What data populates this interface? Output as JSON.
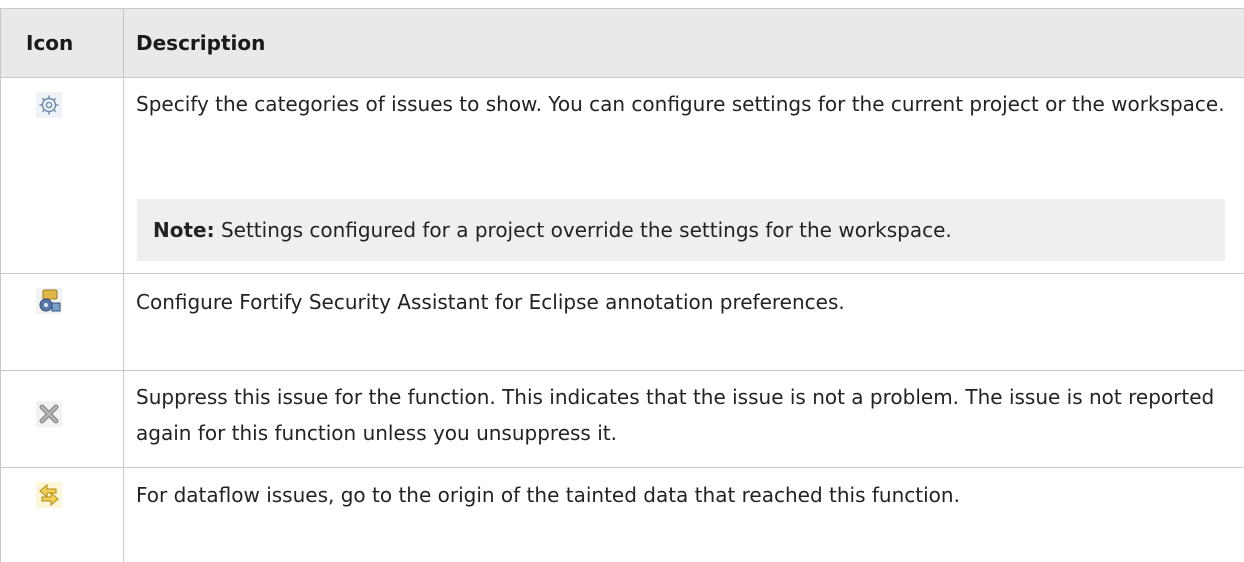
{
  "header": {
    "icon_col": "Icon",
    "description_col": "Description"
  },
  "rows": [
    {
      "icon": "gear-icon",
      "description": "Specify the categories of issues to show. You can configure settings for the current project or the workspace.",
      "note_label": "Note:",
      "note_text": " Settings configured for a project override the settings for the workspace."
    },
    {
      "icon": "annotation-preferences-icon",
      "description": "Configure Fortify Security Assistant for Eclipse annotation preferences."
    },
    {
      "icon": "suppress-icon",
      "description": "Suppress this issue for the function. This indicates that the issue is not a problem. The issue is not reported again for this function unless you unsuppress it."
    },
    {
      "icon": "go-to-origin-icon",
      "description": "For dataflow issues, go to the origin of the tainted data that reached this function."
    }
  ],
  "colors": {
    "header_bg": "#e9e9e9",
    "border": "#c8c8c8",
    "note_bg": "#efefef",
    "text": "#232323"
  }
}
